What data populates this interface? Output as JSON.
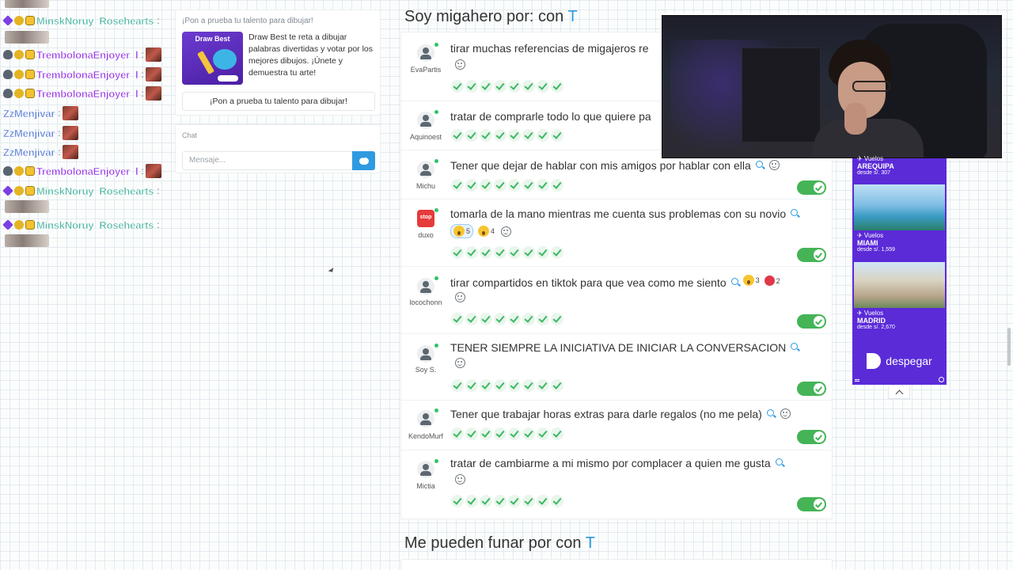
{
  "stream_chat": [
    {
      "kind": "img"
    },
    {
      "kind": "msg",
      "badges": [
        "purple",
        "gold",
        "gift"
      ],
      "name": "MinskNoruy_Rosehearts",
      "color": "teal",
      "colon": ":"
    },
    {
      "kind": "img"
    },
    {
      "kind": "msg",
      "badges": [
        "grey",
        "gold",
        "gift"
      ],
      "name": "TrembolonaEnjoyer_l",
      "color": "violet",
      "colon": ":",
      "emote": true
    },
    {
      "kind": "msg",
      "badges": [
        "grey",
        "gold",
        "gift"
      ],
      "name": "TrembolonaEnjoyer_l",
      "color": "violet",
      "colon": ":",
      "emote": true
    },
    {
      "kind": "msg",
      "badges": [
        "grey",
        "gold",
        "gift"
      ],
      "name": "TrembolonaEnjoyer_l",
      "color": "violet",
      "colon": ":",
      "emote": true
    },
    {
      "kind": "msg",
      "badges": [],
      "name": "ZzMenjivar",
      "color": "blue",
      "colon": ":",
      "emote": true
    },
    {
      "kind": "msg",
      "badges": [],
      "name": "ZzMenjivar",
      "color": "blue",
      "colon": ":",
      "emote": true
    },
    {
      "kind": "msg",
      "badges": [],
      "name": "ZzMenjivar",
      "color": "blue",
      "colon": ":",
      "emote": true
    },
    {
      "kind": "msg",
      "badges": [
        "grey",
        "gold",
        "gift"
      ],
      "name": "TrembolonaEnjoyer_l",
      "color": "violet",
      "colon": ":",
      "emote": true
    },
    {
      "kind": "msg",
      "badges": [
        "purple",
        "gold",
        "gift"
      ],
      "name": "MinskNoruy_Rosehearts",
      "color": "teal",
      "colon": ":"
    },
    {
      "kind": "img"
    },
    {
      "kind": "msg",
      "badges": [
        "purple",
        "gold",
        "gift"
      ],
      "name": "MinskNoruy_Rosehearts",
      "color": "teal",
      "colon": ":"
    },
    {
      "kind": "img"
    }
  ],
  "promo": {
    "title": "¡Pon a prueba tu talento para dibujar!",
    "thumb_label": "Draw Best",
    "description": "Draw Best te reta a dibujar palabras divertidas y votar por los mejores dibujos. ¡Únete y demuestra tu arte!",
    "button": "¡Pon a prueba tu talento para dibujar!"
  },
  "chat": {
    "title": "Chat",
    "placeholder": "Mensaje..."
  },
  "section1": {
    "title": "Soy migahero por: con",
    "accent": "T"
  },
  "section2": {
    "title": "Me pueden funar por con",
    "accent": "T"
  },
  "items": [
    {
      "user": "EvaPartis",
      "avatar": "default",
      "text": "tirar muchas referencias de migajeros re",
      "mag": false,
      "smile_inline": false,
      "smile_row": true,
      "reactions": [],
      "toggle": false
    },
    {
      "user": "Aquinoest",
      "avatar": "default",
      "text": "tratar de comprarle todo lo que quiere pa",
      "mag": false,
      "smile_inline": false,
      "smile_row": false,
      "reactions": [],
      "toggle": false
    },
    {
      "user": "Michu",
      "avatar": "default",
      "text": "Tener que dejar de hablar con mis amigos por hablar con ella",
      "mag": true,
      "smile_inline": true,
      "smile_row": false,
      "reactions": [],
      "toggle": true
    },
    {
      "user": "duxo",
      "avatar": "stop",
      "avatar_text": "stop",
      "text": "tomarla de la mano mientras me cuenta sus problemas con su novio",
      "mag": true,
      "smile_inline": false,
      "smile_row": false,
      "reactions": [
        {
          "type": "face",
          "count": "5",
          "selected": true
        },
        {
          "type": "face",
          "count": "4",
          "selected": false
        }
      ],
      "reaction_smile": true,
      "toggle": true
    },
    {
      "user": "locochonn",
      "avatar": "default",
      "text": "tirar compartidos en tiktok para que vea como me siento",
      "mag": true,
      "smile_inline": false,
      "smile_row": true,
      "inline_reactions": [
        {
          "type": "face",
          "count": "3"
        },
        {
          "type": "heart",
          "count": "2"
        }
      ],
      "reactions": [],
      "toggle": true
    },
    {
      "user": "Soy S.",
      "avatar": "default",
      "text": "TENER SIEMPRE LA INICIATIVA DE INICIAR LA CONVERSACION",
      "mag": true,
      "smile_inline": false,
      "smile_row": true,
      "reactions": [],
      "toggle": true
    },
    {
      "user": "KendoMurf",
      "avatar": "default",
      "text": "Tener que trabajar horas extras para darle regalos (no me pela)",
      "mag": true,
      "smile_inline": true,
      "smile_row": false,
      "reactions": [],
      "toggle": true
    },
    {
      "user": "Mictia",
      "avatar": "default",
      "text": "tratar de cambiarme a mi mismo por complacer a quien me gusta",
      "mag": true,
      "smile_inline": false,
      "smile_row": true,
      "reactions": [],
      "toggle": true
    }
  ],
  "check_count": 8,
  "ad": {
    "cards": [
      {
        "kicker": "✈ Vuelos",
        "city": "AREQUIPA",
        "price": "desde s/. 307"
      },
      {
        "kicker": "✈ Vuelos",
        "city": "MIAMI",
        "price": "desde s/. 1,559"
      },
      {
        "kicker": "✈ Vuelos",
        "city": "MADRID",
        "price": "desde s/. 2,670"
      }
    ],
    "brand": "despegar"
  },
  "colors": {
    "accent": "#2f9ae0",
    "toggle_on": "#44b456",
    "ad_bg": "#5b2bd8"
  }
}
